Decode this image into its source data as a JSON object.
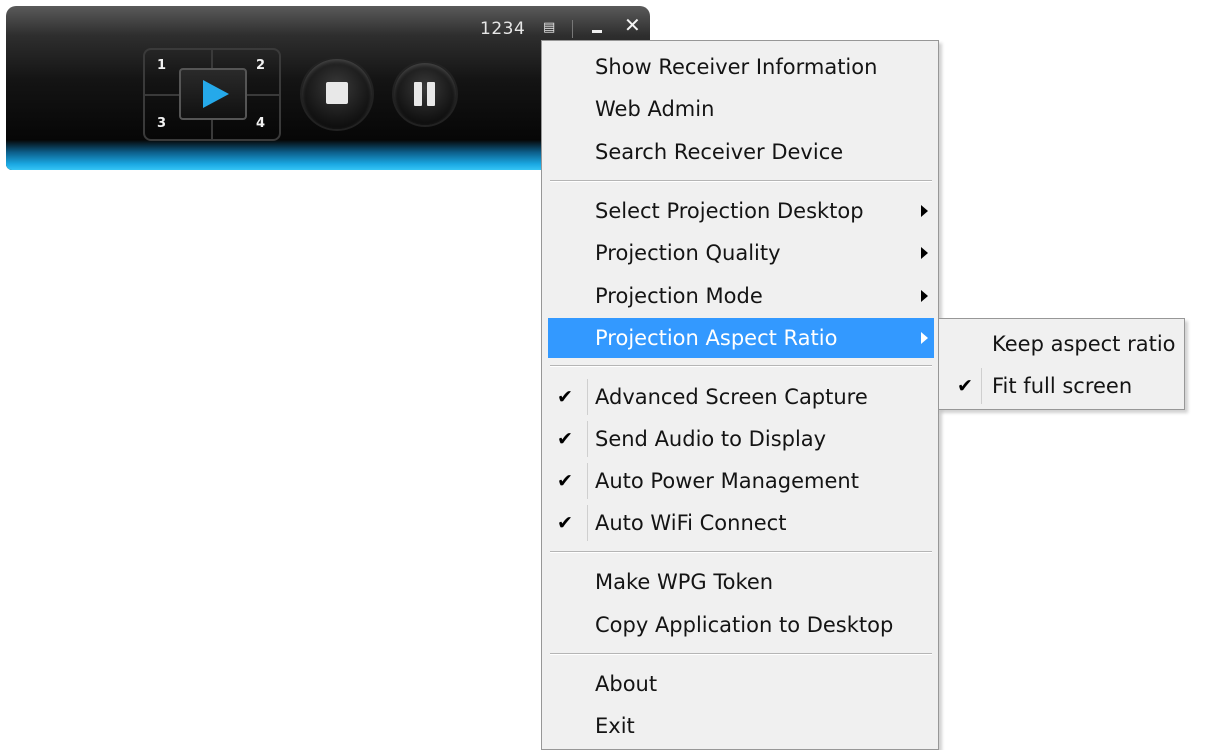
{
  "player": {
    "code": "1234",
    "list_icon": "list-icon",
    "minimize_icon": "minimize-icon",
    "close_icon": "close-icon",
    "quadrants": [
      "1",
      "2",
      "3",
      "4"
    ],
    "play_icon": "play-icon",
    "stop_icon": "stop-icon",
    "pause_icon": "pause-icon",
    "accent_color": "#25a9ea"
  },
  "menu": {
    "items": [
      {
        "label": "Show Receiver Information"
      },
      {
        "label": "Web Admin"
      },
      {
        "label": "Search Receiver Device"
      },
      {
        "label": "Select Projection Desktop"
      },
      {
        "label": "Projection Quality"
      },
      {
        "label": "Projection Mode"
      },
      {
        "label": "Projection Aspect Ratio"
      },
      {
        "label": "Advanced Screen Capture",
        "check": "✔"
      },
      {
        "label": "Send Audio to Display",
        "check": "✔"
      },
      {
        "label": "Auto Power Management",
        "check": "✔"
      },
      {
        "label": "Auto WiFi Connect",
        "check": "✔"
      },
      {
        "label": "Make WPG Token"
      },
      {
        "label": "Copy Application to Desktop"
      },
      {
        "label": "About"
      },
      {
        "label": "Exit"
      }
    ],
    "highlight_color": "#3399ff"
  },
  "submenu": {
    "items": [
      {
        "label": "Keep aspect ratio"
      },
      {
        "label": "Fit full screen",
        "check": "✔"
      }
    ]
  }
}
